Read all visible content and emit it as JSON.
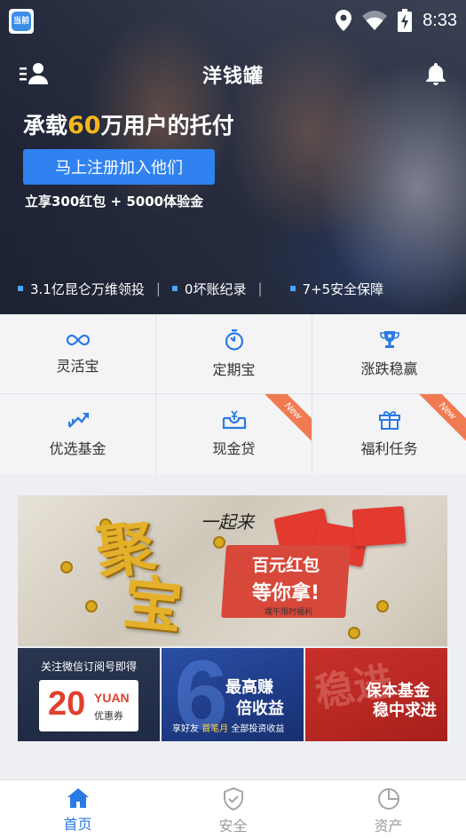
{
  "status_bar": {
    "time": "8:33",
    "app_badge_text": "当前",
    "icons": [
      "location-icon",
      "wifi-icon",
      "battery-charging-icon"
    ]
  },
  "header": {
    "title": "洋钱罐",
    "left_icon": "user-menu-icon",
    "right_icon": "bell-icon"
  },
  "hero": {
    "headline_prefix": "承载",
    "headline_number": "60",
    "headline_suffix": "万用户的托付",
    "cta_label": "马上注册加入他们",
    "cta_sub": "立享300红包 + 5000体验金",
    "features": [
      "3.1亿昆仑万维领投",
      "0坏账纪录",
      "7+5安全保障"
    ],
    "feature_separator": "|",
    "colors": {
      "accent": "#f6b71c",
      "button": "#2f82f0"
    }
  },
  "grid": {
    "items": [
      {
        "label": "灵活宝",
        "icon": "infinity-icon",
        "badge": ""
      },
      {
        "label": "定期宝",
        "icon": "timer-icon",
        "badge": ""
      },
      {
        "label": "涨跌稳赢",
        "icon": "trophy-icon",
        "badge": ""
      },
      {
        "label": "优选基金",
        "icon": "trend-up-icon",
        "badge": ""
      },
      {
        "label": "现金贷",
        "icon": "cash-box-icon",
        "badge": "New"
      },
      {
        "label": "福利任务",
        "icon": "gift-icon",
        "badge": "New"
      }
    ],
    "icon_color": "#2a7ae4",
    "badge_color": "#f07b52"
  },
  "promo": {
    "banner": {
      "big_char_1": "聚",
      "big_char_2": "宝",
      "tagline": "一起来",
      "line1": "百元红包",
      "line2": "等你拿!",
      "footnote": "端午限时福利"
    },
    "tiles": [
      {
        "top": "关注微信订阅号即得",
        "amount": "20",
        "unit": "YUAN",
        "label": "优惠券"
      },
      {
        "line1": "最高赚",
        "line2": "倍收益",
        "foot_a": "享好友 ",
        "foot_hl": "首笔月",
        "foot_b": " 全部投资收益"
      },
      {
        "line1": "保本基金",
        "line2": "稳中求进"
      }
    ]
  },
  "tabbar": {
    "tabs": [
      {
        "label": "首页",
        "icon": "home-icon",
        "active": true
      },
      {
        "label": "安全",
        "icon": "shield-check-icon",
        "active": false
      },
      {
        "label": "资产",
        "icon": "pie-chart-icon",
        "active": false
      }
    ],
    "active_color": "#2a7ae4",
    "inactive_color": "#9c9c9c"
  }
}
